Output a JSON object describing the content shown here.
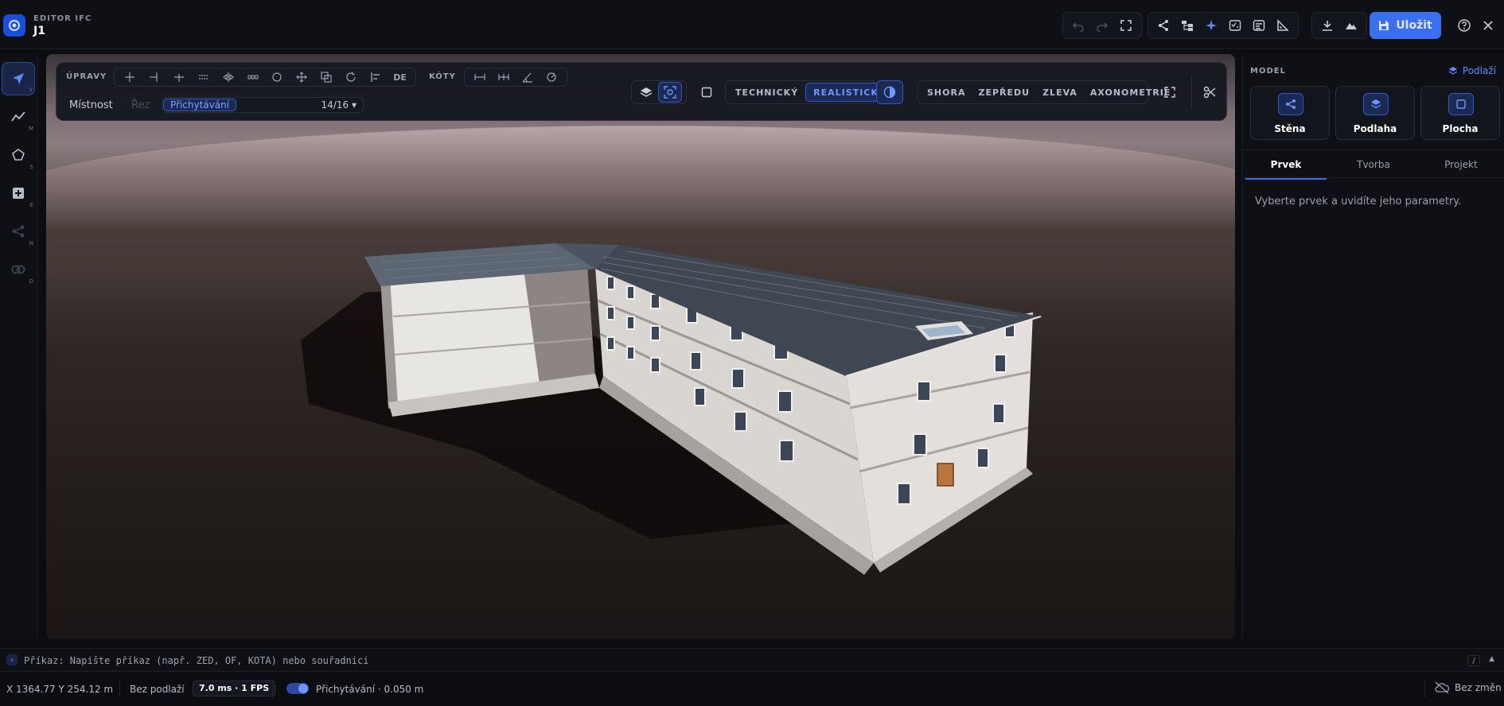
{
  "header": {
    "app_name": "EDITOR IFC",
    "document_name": "J1",
    "save_label": "Uložit"
  },
  "left_toolbar": {
    "tools": [
      {
        "name": "select",
        "key": "V"
      },
      {
        "name": "polyline",
        "key": "M"
      },
      {
        "name": "polygon",
        "key": "S"
      },
      {
        "name": "add",
        "key": "E"
      },
      {
        "name": "connect",
        "key": "N"
      },
      {
        "name": "measure",
        "key": "D"
      }
    ]
  },
  "viewport_toolbar": {
    "edits_label": "ÚPRAVY",
    "de_label": "DE",
    "dimensions_label": "KÓTY",
    "room_label": "Místnost",
    "cut_label": "Řez",
    "snap_label": "Přichytávání",
    "snap_count": "14/16",
    "mode_technical": "TECHNICKÝ",
    "mode_realistic": "REALISTICKÝ",
    "view_top": "SHORA",
    "view_front": "ZEPŘEDU",
    "view_left": "ZLEVA",
    "view_axonometric": "AXONOMETRIE"
  },
  "right_panel": {
    "title": "MODEL",
    "layers_label": "Podlaží",
    "cards": [
      "Stěna",
      "Podlaha",
      "Plocha"
    ],
    "tabs": [
      "Prvek",
      "Tvorba",
      "Projekt"
    ],
    "active_tab": "Prvek",
    "empty_message": "Vyberte prvek a uvidíte jeho parametry."
  },
  "command_line": {
    "text": "Příkaz: Napište příkaz (např. ZED, OF, KOTA) nebo souřadnici",
    "shortcut": "/"
  },
  "status_bar": {
    "coordinates": "X 1364.77 Y 254.12 m",
    "floor": "Bez podlaží",
    "performance": "7.0 ms · 1 FPS",
    "snapping": "Přichytávání · 0.050 m",
    "changes": "Bez změn"
  }
}
